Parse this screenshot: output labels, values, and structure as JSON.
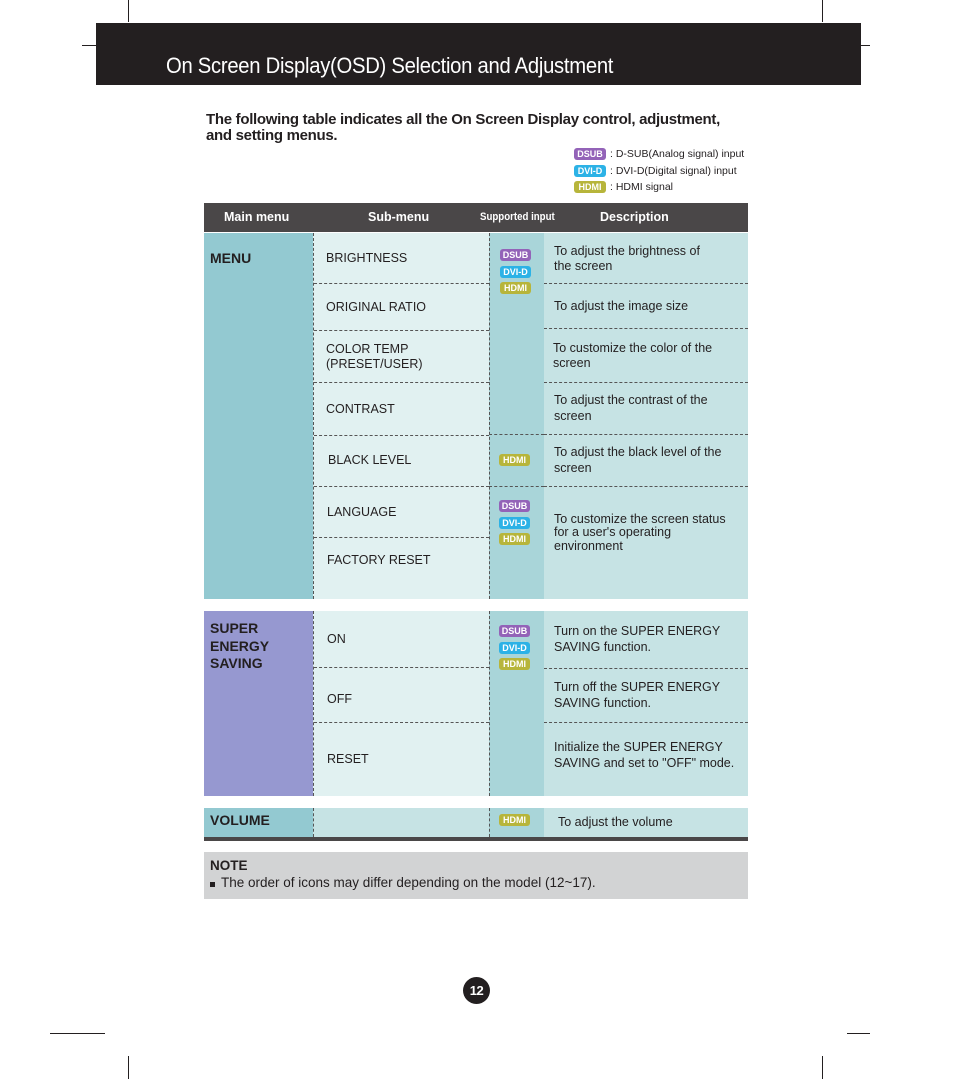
{
  "header": {
    "title": "On Screen Display(OSD) Selection and Adjustment"
  },
  "intro": "The following table indicates all the On Screen Display control, adjustment, and setting menus.",
  "legend": [
    {
      "badge": "DSUB",
      "text": ": D-SUB(Analog signal) input"
    },
    {
      "badge": "DVI-D",
      "text": ": DVI-D(Digital signal) input"
    },
    {
      "badge": "HDMI",
      "text": ": HDMI signal"
    }
  ],
  "colors": {
    "dsub": "#9363b8",
    "dvid": "#2cb2e6",
    "hdmi": "#b7b53b",
    "menu_bg": "#93c9d1",
    "super_bg": "#9698d0"
  },
  "table": {
    "headers": {
      "main": "Main menu",
      "sub": "Sub-menu",
      "input": "Supported input",
      "desc": "Description"
    },
    "menu": {
      "label": "MENU",
      "rows": [
        {
          "sub": "BRIGHTNESS",
          "desc": "To adjust the brightness of the screen"
        },
        {
          "sub": "ORIGINAL RATIO",
          "desc": "To adjust the image size"
        },
        {
          "sub": "COLOR TEMP (PRESET/USER)",
          "desc": "To customize the color of the screen"
        },
        {
          "sub": "CONTRAST",
          "desc": "To adjust the contrast of the screen"
        },
        {
          "sub": "BLACK LEVEL",
          "desc": "To adjust the black level of the screen"
        },
        {
          "sub": "LANGUAGE",
          "desc": "To customize the screen status for a user's operating environment"
        },
        {
          "sub": "FACTORY RESET",
          "desc": ""
        }
      ],
      "inputs_group1": [
        "DSUB",
        "DVI-D",
        "HDMI"
      ],
      "inputs_group2": [
        "HDMI"
      ],
      "inputs_group3": [
        "DSUB",
        "DVI-D",
        "HDMI"
      ]
    },
    "super_energy": {
      "label": "SUPER ENERGY SAVING",
      "rows": [
        {
          "sub": "ON",
          "desc": "Turn on the SUPER ENERGY SAVING function."
        },
        {
          "sub": "OFF",
          "desc": "Turn off the SUPER ENERGY SAVING function."
        },
        {
          "sub": "RESET",
          "desc": "Initialize the SUPER ENERGY SAVING and set to \"OFF\" mode."
        }
      ],
      "inputs": [
        "DSUB",
        "DVI-D",
        "HDMI"
      ]
    },
    "volume": {
      "label": "VOLUME",
      "sub": "",
      "inputs": [
        "HDMI"
      ],
      "desc": "To adjust the volume"
    }
  },
  "note": {
    "title": "NOTE",
    "text": "The order of icons may differ depending on the model (12~17)."
  },
  "page_number": "12"
}
